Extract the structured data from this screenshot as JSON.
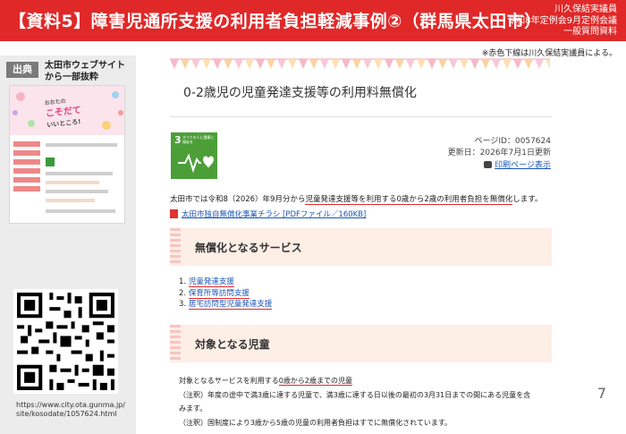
{
  "header": {
    "title": "【資料5】障害児通所支援の利用者負担軽減事例②（群馬県太田市）",
    "meta_lines": [
      "川久保結実議員",
      "令和8年定例会9月定例会議",
      "一般質問資料"
    ]
  },
  "note_top": "※赤色下線は川久保結実議員による。",
  "source": {
    "badge": "出典",
    "text_line1": "太田市ウェブサイト",
    "text_line2": "から一部抜粋"
  },
  "thumbnail": {
    "banner_line1": "おおたの",
    "banner_line2": "こそだて",
    "banner_line3": "いいところ!"
  },
  "qr_url": "https://www.city.ota.gunma.jp/site/kosodate/1057624.html",
  "page": {
    "title": "0-2歳児の児童発達支援等の利用料無償化",
    "sdg_number": "3",
    "sdg_label": "すべての人に健康と福祉を",
    "page_id": "ページID：0057624",
    "updated": "更新日：2026年7月1日更新",
    "print_link": "印刷ページ表示",
    "body_before": "太田市では令和8（2026）年9月分から",
    "body_underlined": "児童発達支援等を利用する0歳から2歳の利用者負担を無償化",
    "body_after": "します。",
    "pdf_link": "太田市独自無償化事業チラシ [PDFファイル／160KB]",
    "section1_title": "無償化となるサービス",
    "services": [
      {
        "num": "1.",
        "label": "児童発達支援"
      },
      {
        "num": "2.",
        "label": "保育所等訪問支援"
      },
      {
        "num": "3.",
        "label": "居宅訪問型児童発達支援"
      }
    ],
    "section2_title": "対象となる児童",
    "child_before": "対象となるサービスを利用する",
    "child_underlined": "0歳から2歳までの児童",
    "note1": "（注釈）年度の途中で満3歳に達する児童で、満3歳に達する日以後の最初の3月31日までの間にある児童を含",
    "note1b": "みます。",
    "note2": "（注釈）国制度により3歳から5歳の児童の利用者負担はすでに無償化されています。"
  },
  "slide_number": "7",
  "colors": {
    "header_red": "#e02828",
    "link_blue": "#1a56b8",
    "section_bg": "#fdeee6",
    "sdg_green": "#4c9f38"
  }
}
